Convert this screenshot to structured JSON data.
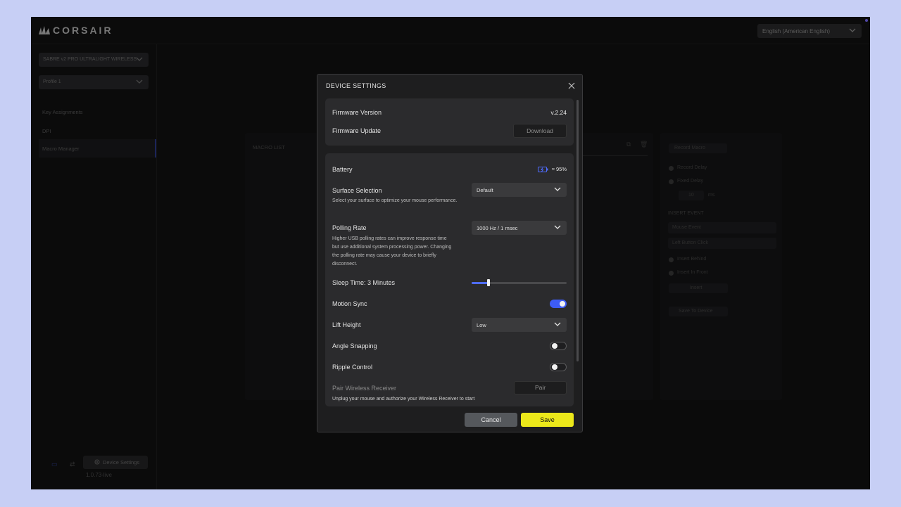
{
  "app": {
    "brand": "CORSAIR",
    "language": "English (American English)"
  },
  "sidebar": {
    "device_select": "SABRE v2 PRO ULTRALIGHT WIRELESS",
    "profile_select": "Profile 1",
    "items": [
      {
        "label": "Key Assignments"
      },
      {
        "label": "DPI"
      },
      {
        "label": "Macro Manager"
      }
    ],
    "device_settings_button": "Device Settings",
    "version": "1.0.73-live"
  },
  "background": {
    "macro_list_header": "MACRO LIST",
    "record_macro_button": "Record Macro",
    "record_delay": "Record Delay",
    "fixed_delay": "Fixed Delay",
    "delay_value": "10",
    "delay_unit": "ms",
    "insert_event_header": "INSERT EVENT",
    "event_type": "Mouse Event",
    "event_action": "Left Button Click",
    "insert_behind": "Insert Behind",
    "insert_in_front": "Insert In Front",
    "insert_button": "Insert",
    "save_to_device_button": "Save To Device"
  },
  "modal": {
    "title": "DEVICE SETTINGS",
    "firmware_version_label": "Firmware Version",
    "firmware_version_value": "v.2.24",
    "firmware_update_label": "Firmware Update",
    "download_button": "Download",
    "battery_label": "Battery",
    "battery_value": "≈ 95%",
    "surface_label": "Surface Selection",
    "surface_value": "Default",
    "surface_desc": "Select your surface to optimize your mouse performance.",
    "polling_label": "Polling Rate",
    "polling_value": "1000 Hz / 1 msec",
    "polling_desc_lines": [
      "Higher USB polling rates can improve response time",
      "but use additional system processing power. Changing",
      "the polling rate may cause your device to briefly",
      "disconnect."
    ],
    "sleep_label": "Sleep Time: 3 Minutes",
    "sleep_level_fraction": 0.18,
    "motion_sync_label": "Motion Sync",
    "motion_sync_on": true,
    "lift_height_label": "Lift Height",
    "lift_height_value": "Low",
    "angle_snapping_label": "Angle Snapping",
    "angle_snapping_on": false,
    "ripple_control_label": "Ripple Control",
    "ripple_control_on": false,
    "pair_label": "Pair Wireless Receiver",
    "pair_button": "Pair",
    "pair_desc": "Unplug your mouse and authorize your Wireless Receiver to start",
    "cancel_button": "Cancel",
    "save_button": "Save"
  },
  "colors": {
    "accent_blue": "#3d5cf5",
    "save_yellow": "#ece81a",
    "modal_bg": "#1e1e1f",
    "card_bg": "#2b2b2d"
  },
  "icons": [
    "corsair-sails-icon",
    "chevron-down-icon",
    "close-icon",
    "battery-icon",
    "gear-icon",
    "copy-icon",
    "trash-icon"
  ]
}
